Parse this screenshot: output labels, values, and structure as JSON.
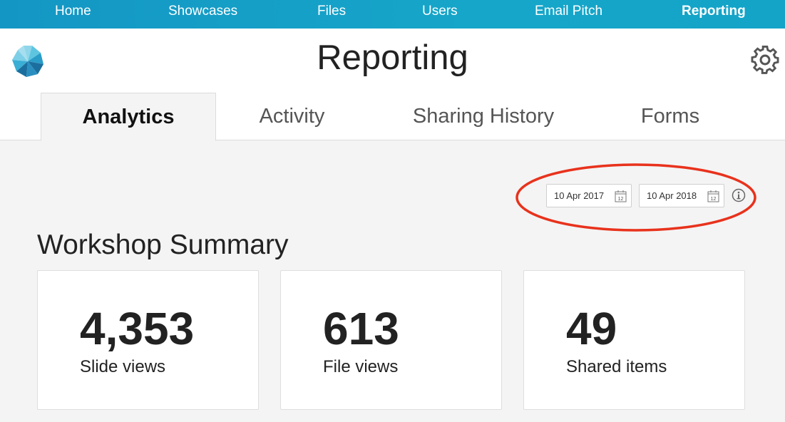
{
  "topnav": {
    "items": [
      {
        "label": "Home"
      },
      {
        "label": "Showcases"
      },
      {
        "label": "Files"
      },
      {
        "label": "Users"
      },
      {
        "label": "Email Pitch"
      },
      {
        "label": "Reporting"
      }
    ],
    "active": "Reporting"
  },
  "header": {
    "title": "Reporting",
    "logo_icon": "star-logo-icon",
    "settings_icon": "gear-icon"
  },
  "tabs": [
    {
      "label": "Analytics"
    },
    {
      "label": "Activity"
    },
    {
      "label": "Sharing History"
    },
    {
      "label": "Forms"
    }
  ],
  "active_tab": "Analytics",
  "date_range": {
    "start": "10 Apr 2017",
    "end": "10 Apr 2018",
    "calendar_icon": "calendar-icon",
    "calendar_day": "12",
    "info_icon": "info-icon",
    "annotation_color": "#e8321c"
  },
  "summary": {
    "title": "Workshop Summary",
    "cards": [
      {
        "value": "4,353",
        "label": "Slide views"
      },
      {
        "value": "613",
        "label": "File views"
      },
      {
        "value": "49",
        "label": "Shared items"
      }
    ]
  },
  "colors": {
    "nav_bar": "#16a6c9",
    "logo_light": "#5ec5e0",
    "logo_dark": "#1b6f9e"
  }
}
